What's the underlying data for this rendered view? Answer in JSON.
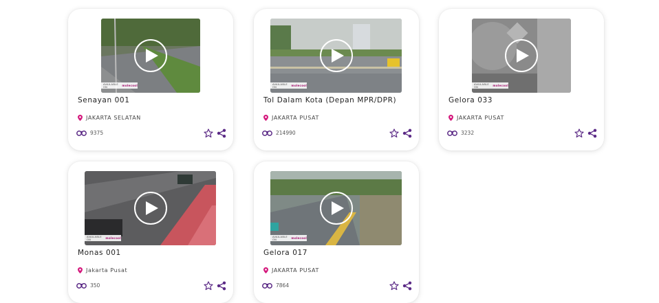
{
  "cameras": [
    {
      "title": "Senayan 001",
      "location": "JAKARTA SELATAN",
      "views": "9375"
    },
    {
      "title": "Tol Dalam Kota (Depan MPR/DPR)",
      "location": "JAKARTA PUSAT",
      "views": "214990"
    },
    {
      "title": "Gelora 033",
      "location": "JAKARTA PUSAT",
      "views": "3232"
    },
    {
      "title": "Monas 001",
      "location": "Jakarta Pusat",
      "views": "350"
    },
    {
      "title": "Gelora 017",
      "location": "JAKARTA PUSAT",
      "views": "7864"
    }
  ],
  "badge": {
    "available_on": "AVAILABLE ON",
    "brand": "molecool"
  },
  "colors": {
    "accent": "#5b2a86",
    "pin": "#d4187c",
    "card_bg": "#ffffff"
  },
  "icons": {
    "play": "play-icon",
    "pin": "location-pin-icon",
    "views": "binoculars-icon",
    "favorite": "star-icon",
    "share": "share-icon"
  }
}
